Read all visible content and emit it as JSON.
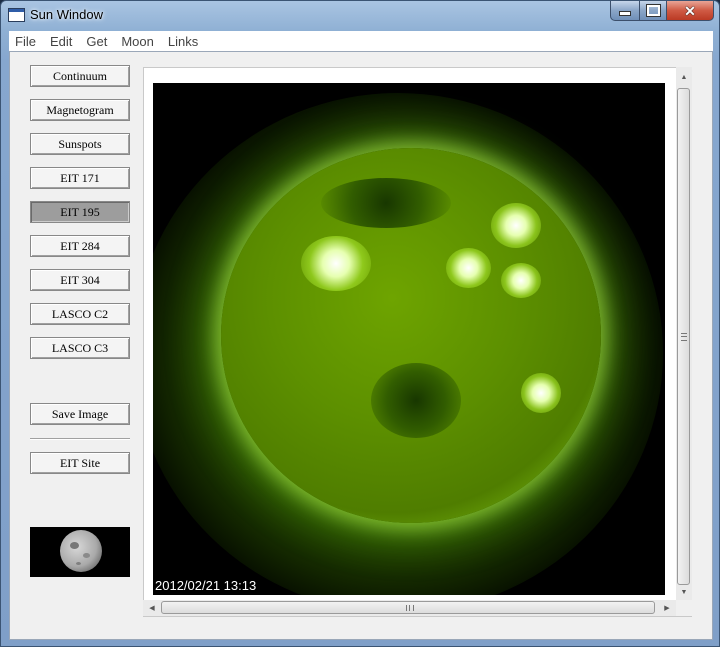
{
  "window": {
    "title": "Sun Window"
  },
  "menu": [
    "File",
    "Edit",
    "Get",
    "Moon",
    "Links"
  ],
  "buttons": {
    "continuum": "Continuum",
    "magnetogram": "Magnetogram",
    "sunspots": "Sunspots",
    "eit171": "EIT 171",
    "eit195": "EIT 195",
    "eit284": "EIT 284",
    "eit304": "EIT 304",
    "lasco_c2": "LASCO C2",
    "lasco_c3": "LASCO C3",
    "save_image": "Save Image",
    "eit_site": "EIT Site"
  },
  "selected_button": "EIT 195",
  "image": {
    "timestamp": "2012/02/21  13:13"
  },
  "icons": {
    "app": "window-icon",
    "minimize": "minimize-icon",
    "maximize": "maximize-icon",
    "close": "close-icon",
    "up": "arrow-up-icon",
    "down": "arrow-down-icon",
    "left": "arrow-left-icon",
    "right": "arrow-right-icon",
    "moon": "moon-phase-icon"
  },
  "colors": {
    "sun": "#5d9000",
    "active_button": "#9d9d9d",
    "close_button": "#cf5a44"
  },
  "glyphs": {
    "close": "✕",
    "up": "▲",
    "down": "▼",
    "left": "◀",
    "right": "▶"
  }
}
